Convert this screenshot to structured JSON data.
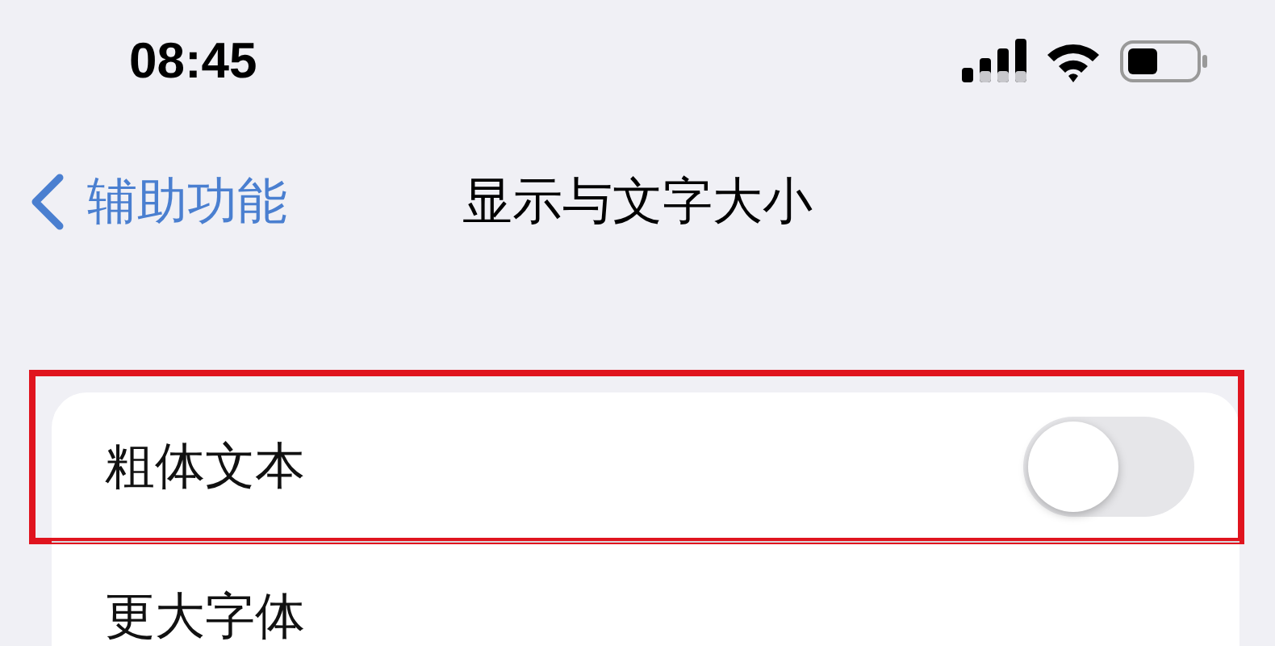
{
  "status_bar": {
    "time": "08:45"
  },
  "nav": {
    "back": "辅助功能",
    "title": "显示与文字大小"
  },
  "rows": [
    {
      "kind": "toggle",
      "label": "粗体文本",
      "on": false,
      "highlighted": true
    },
    {
      "kind": "plain",
      "label": "更大字体",
      "highlighted": false
    }
  ]
}
